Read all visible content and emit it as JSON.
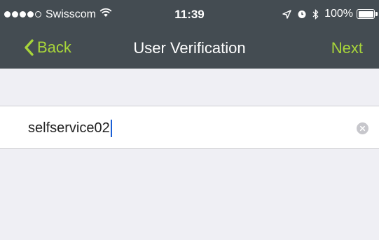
{
  "status_bar": {
    "carrier": "Swisscom",
    "time": "11:39",
    "battery": "100%",
    "signal_icon": "signal-dots-icon",
    "wifi_icon": "wifi-icon",
    "location_icon": "location-arrow-icon",
    "alarm_icon": "alarm-icon",
    "bluetooth_icon": "bluetooth-icon",
    "battery_icon": "battery-icon"
  },
  "nav": {
    "back_label": "Back",
    "title": "User Verification",
    "next_label": "Next"
  },
  "form": {
    "username_value": "selfservice02",
    "clear_icon": "clear-icon"
  },
  "colors": {
    "nav_background": "#444c52",
    "accent": "#a8d53a",
    "page_background": "#efeff4",
    "caret": "#1a5fd6"
  }
}
